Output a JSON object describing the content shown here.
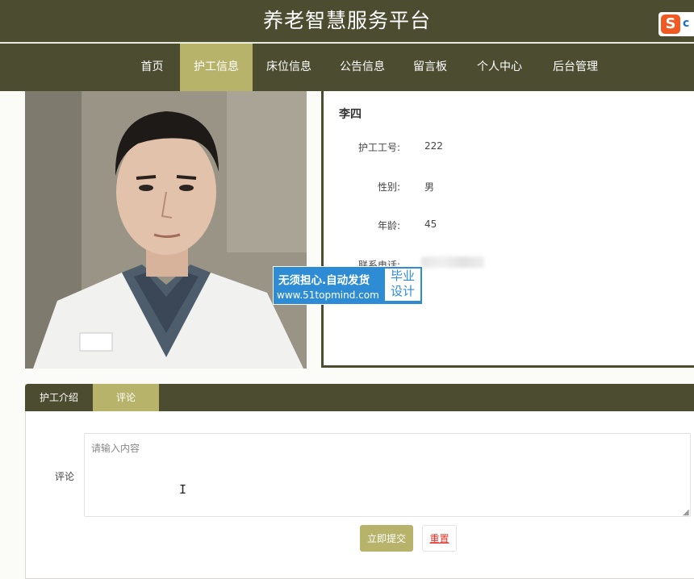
{
  "header": {
    "title": "养老智慧服务平台"
  },
  "ime": {
    "logo_letter": "S",
    "extra": "c"
  },
  "nav": {
    "items": [
      {
        "label": "首页"
      },
      {
        "label": "护工信息"
      },
      {
        "label": "床位信息"
      },
      {
        "label": "公告信息"
      },
      {
        "label": "留言板"
      },
      {
        "label": "个人中心"
      },
      {
        "label": "后台管理"
      }
    ],
    "active_index": 1
  },
  "caregiver": {
    "name": "李四",
    "fields": [
      {
        "label": "护工工号:",
        "value": "222"
      },
      {
        "label": "性别:",
        "value": "男"
      },
      {
        "label": "年龄:",
        "value": "45"
      },
      {
        "label": "联系电话:",
        "value": ""
      }
    ]
  },
  "watermark": {
    "line1": "无须担心.自动发货",
    "line2": "www.51topmind.com",
    "box_line1": "毕业",
    "box_line2": "设计"
  },
  "tabs": {
    "items": [
      {
        "label": "护工介绍"
      },
      {
        "label": "评论"
      }
    ],
    "active_index": 1
  },
  "comment_form": {
    "label": "评论",
    "placeholder": "请输入内容",
    "submit_label": "立即提交",
    "reset_label": "重置"
  },
  "colors": {
    "primary": "#4c4d30",
    "accent": "#b8b36a",
    "reset_text": "#e0342b"
  }
}
